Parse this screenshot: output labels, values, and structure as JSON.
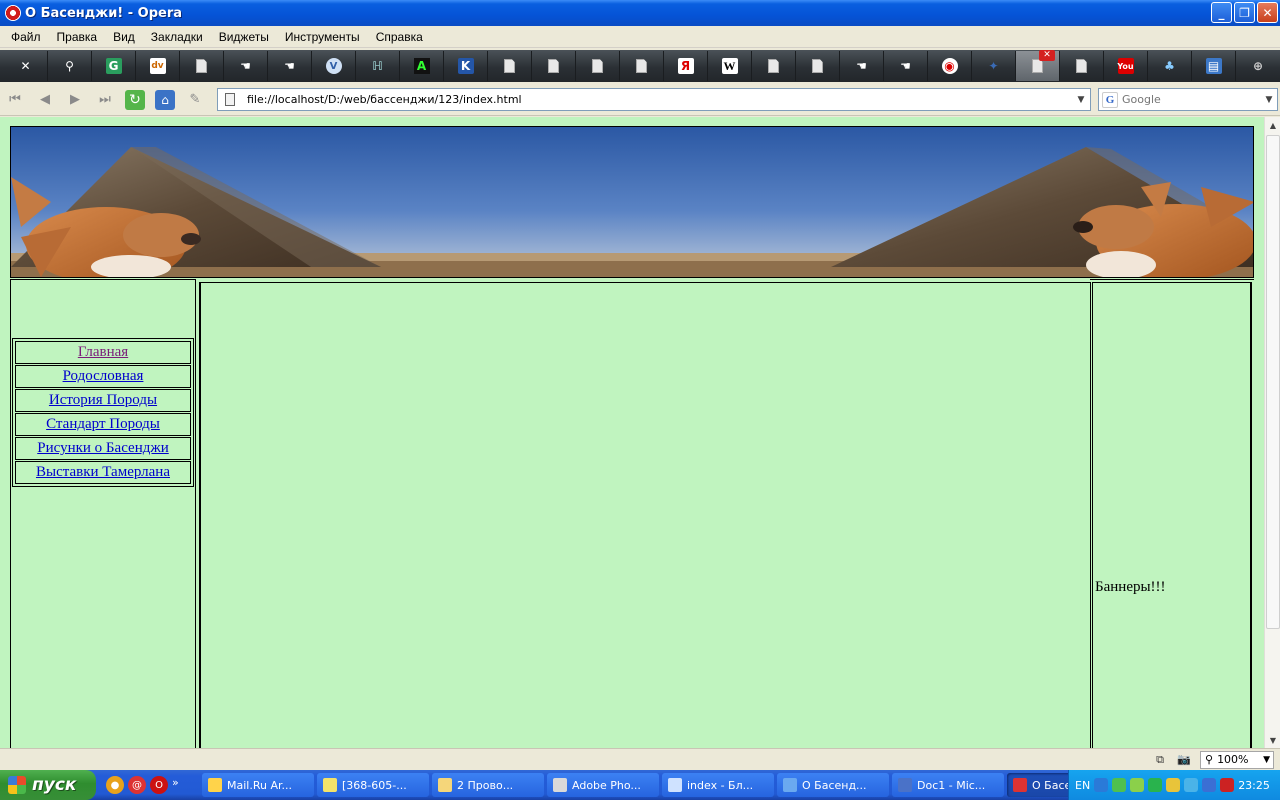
{
  "window": {
    "title": "О Басенджи! - Opera"
  },
  "menu": [
    "Файл",
    "Правка",
    "Вид",
    "Закладки",
    "Виджеты",
    "Инструменты",
    "Справка"
  ],
  "address": {
    "url": "file://localhost/D:/web/бассенджи/123/index.html",
    "search_placeholder": "Google"
  },
  "sidebar": {
    "links": [
      {
        "label": "Главная",
        "visited": true
      },
      {
        "label": "Родословная",
        "visited": false
      },
      {
        "label": "История Породы",
        "visited": false
      },
      {
        "label": "Стандарт Породы",
        "visited": false
      },
      {
        "label": "Рисунки о Басенджи",
        "visited": false
      },
      {
        "label": "Выставки Тамерлана",
        "visited": false
      }
    ]
  },
  "right_panel": {
    "text": "Баннеры!!!"
  },
  "colors": {
    "page_background": "#c0f4bf",
    "link": "#0000cc",
    "visited_link": "#7a1c7a"
  },
  "statusbar": {
    "zoom": "100%"
  },
  "taskbar": {
    "start_label": "пуск",
    "tasks": [
      {
        "label": "Mail.Ru Ar...",
        "active": false
      },
      {
        "label": "[368-605-...",
        "active": false
      },
      {
        "label": "2 Прово...",
        "active": false
      },
      {
        "label": "Adobe Pho...",
        "active": false
      },
      {
        "label": "index - Бл...",
        "active": false
      },
      {
        "label": "О Басенд...",
        "active": false
      },
      {
        "label": "Doc1 - Mic...",
        "active": false
      },
      {
        "label": "О Басенд...",
        "active": true
      }
    ],
    "language": "EN",
    "clock": "23:25"
  }
}
